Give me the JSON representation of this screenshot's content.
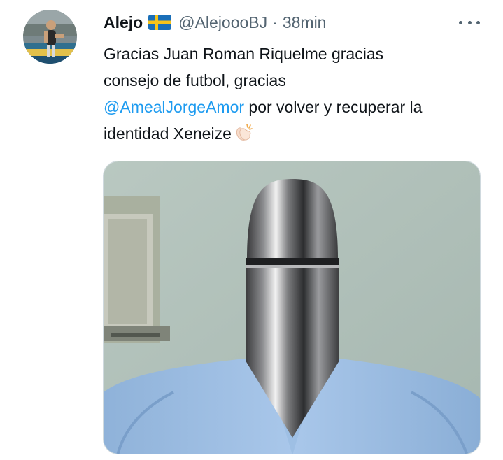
{
  "tweet": {
    "display_name": "Alejo",
    "flag_icon": "sweden-flag-icon",
    "handle": "@AlejoooBJ",
    "separator": "·",
    "time": "38min",
    "more_icon": "more-options-icon",
    "text": {
      "line1": "Gracias Juan Roman Riquelme gracias",
      "line2": "consejo de futbol, gracias",
      "mention": "@AmealJorgeAmor",
      "line3_rest": " por volver y recuperar la",
      "line4": "identidad Xeneize",
      "emoji": "clapping-hands-emoji"
    },
    "colors": {
      "link": "#1d9bf0",
      "secondary": "#536471",
      "primary_text": "#0f1419"
    }
  }
}
